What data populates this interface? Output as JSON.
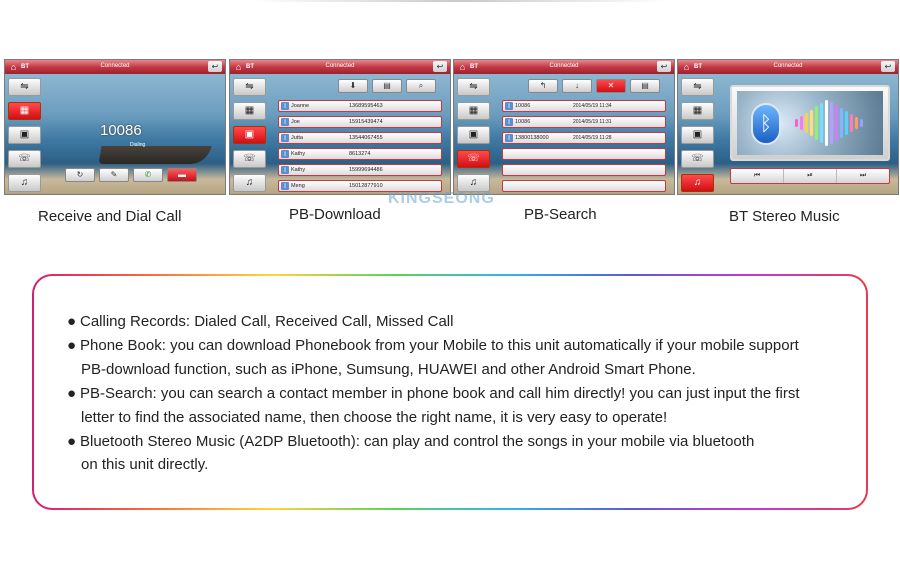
{
  "watermark": "KINGSEONG",
  "screens": {
    "common": {
      "bt_label": "BT",
      "status": "Connected"
    },
    "receive": {
      "caption": "Receive and Dial Call",
      "number": "10086",
      "status_text": "Dialing"
    },
    "download": {
      "caption": "PB-Download",
      "contacts": [
        {
          "name": "Joanne",
          "phone": "13689595463"
        },
        {
          "name": "Joe",
          "phone": "15915439474"
        },
        {
          "name": "Jutta",
          "phone": "13544067455"
        },
        {
          "name": "Kathy",
          "phone": "8613274"
        },
        {
          "name": "Kathy",
          "phone": "15999694486"
        },
        {
          "name": "Meng",
          "phone": "15012877910"
        }
      ]
    },
    "search": {
      "caption": "PB-Search",
      "records": [
        {
          "number": "10086",
          "date": "2014/05/19 11:34"
        },
        {
          "number": "10086",
          "date": "2014/05/19 11:31"
        },
        {
          "number": "13800138000",
          "date": "2014/05/19 11:28"
        }
      ]
    },
    "music": {
      "caption": "BT Stereo Music"
    }
  },
  "features": [
    {
      "lines": [
        "Calling Records: Dialed Call, Received Call, Missed Call"
      ]
    },
    {
      "lines": [
        "Phone Book: you can download Phonebook from your Mobile to this unit automatically if your mobile support",
        "PB-download function, such as iPhone, Sumsung, HUAWEI and other Android Smart Phone."
      ]
    },
    {
      "lines": [
        "PB-Search: you can search a contact member in phone book and call him directly! you can just input the first",
        "letter to find the associated name, then choose the right name, it is very easy to operate!"
      ]
    },
    {
      "lines": [
        "Bluetooth Stereo Music (A2DP Bluetooth): can play and control the songs in your mobile via bluetooth",
        "on this unit directly."
      ]
    }
  ],
  "icons": {
    "home": "home-icon",
    "back": "back-icon",
    "bluetooth": "bluetooth-icon"
  },
  "colors": {
    "accent": "#d10e16",
    "titlebar": "#c23a45"
  }
}
